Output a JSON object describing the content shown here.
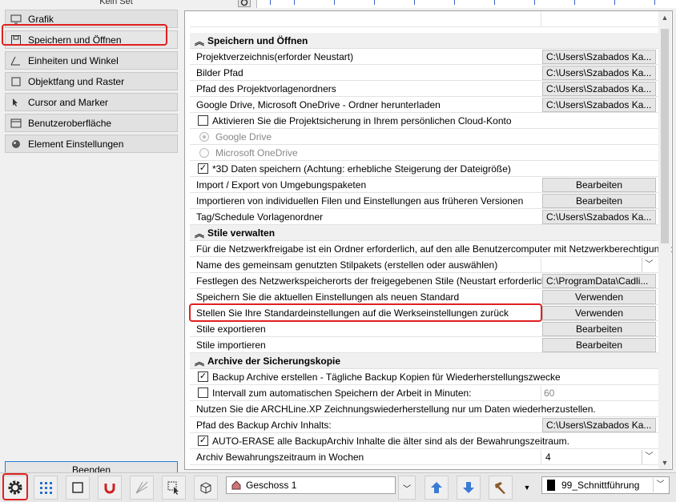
{
  "top": {
    "set_label": "Kein Set"
  },
  "nav": {
    "items": [
      {
        "label": "Grafik",
        "icon": "monitor-icon"
      },
      {
        "label": "Speichern und Öffnen",
        "icon": "floppy-disk-icon"
      },
      {
        "label": "Einheiten und Winkel",
        "icon": "angle-icon"
      },
      {
        "label": "Objektfang und Raster",
        "icon": "snap-frame-icon"
      },
      {
        "label": "Cursor and Marker",
        "icon": "cursor-icon"
      },
      {
        "label": "Benutzeroberfläche",
        "icon": "window-icon"
      },
      {
        "label": "Element Einstellungen",
        "icon": "sphere-icon"
      }
    ],
    "selected": "Speichern und Öffnen",
    "exit_label": "Beenden"
  },
  "settings": {
    "section1": {
      "title": "Speichern und Öffnen",
      "rows": {
        "projektverzeichnis": {
          "label": "Projektverzeichnis(erforder Neustart)",
          "value": "C:\\Users\\Szabados Ka..."
        },
        "bilder": {
          "label": "Bilder Pfad",
          "value": "C:\\Users\\Szabados Ka..."
        },
        "vorlagen": {
          "label": "Pfad des Projektvorlagenordners",
          "value": "C:\\Users\\Szabados Ka..."
        },
        "cloud_dl": {
          "label": "Google Drive, Microsoft OneDrive - Ordner herunterladen",
          "value": "C:\\Users\\Szabados Ka..."
        },
        "cloud_backup": {
          "label": "Aktivieren Sie die Projektsicherung in Ihrem persönlichen Cloud-Konto",
          "checked": false
        },
        "google": {
          "label": "Google Drive"
        },
        "onedrive": {
          "label": "Microsoft OneDrive"
        },
        "save3d": {
          "label": "*3D Daten speichern (Achtung: erhebliche Steigerung der Dateigröße)",
          "checked": true
        },
        "import_export": {
          "label": "Import / Export von Umgebungspaketen",
          "value": "Bearbeiten"
        },
        "import_files": {
          "label": "Importieren von individuellen Filen und Einstellungen aus früheren Versionen",
          "value": "Bearbeiten"
        },
        "tag_schedule": {
          "label": "Tag/Schedule Vorlagenordner",
          "value": "C:\\Users\\Szabados Ka..."
        }
      }
    },
    "section2": {
      "title": "Stile verwalten",
      "rows": {
        "info": {
          "label": "Für die Netzwerkfreigabe ist ein Ordner erforderlich, auf den alle Benutzercomputer mit Netzwerkberechtigung zu..."
        },
        "stilpaket": {
          "label": "Name des gemeinsam genutzten Stilpakets (erstellen oder auswählen)",
          "value": ""
        },
        "speicherort": {
          "label": "Festlegen des Netzwerkspeicherorts der freigegebenen Stile (Neustart erforderlich)",
          "value": "C:\\ProgramData\\Cadli..."
        },
        "als_standard": {
          "label": "Speichern Sie die aktuellen Einstellungen als neuen Standard",
          "value": "Verwenden"
        },
        "werkseinstellungen": {
          "label": "Stellen Sie Ihre Standardeinstellungen auf die Werkseinstellungen zurück",
          "value": "Verwenden"
        },
        "exportieren": {
          "label": "Stile exportieren",
          "value": "Bearbeiten"
        },
        "importieren": {
          "label": "Stile importieren",
          "value": "Bearbeiten"
        }
      }
    },
    "section3": {
      "title": "Archive der Sicherungskopie",
      "rows": {
        "backup": {
          "label": "Backup Archive erstellen - Tägliche Backup Kopien für Wiederherstellungszwecke",
          "checked": true
        },
        "intervall": {
          "label": "Intervall zum automatischen Speichern der Arbeit in Minuten:",
          "checked": false,
          "value": "60"
        },
        "info": {
          "label": "Nutzen Sie die ARCHLine.XP Zeichnungswiederherstellung nur um Daten wiederherzustellen."
        },
        "pfad": {
          "label": "Pfad des Backup Archiv Inhalts:",
          "value": "C:\\Users\\Szabados Ka..."
        },
        "auto_erase": {
          "label": "AUTO-ERASE alle BackupArchiv Inhalte die älter sind als der Bewahrungszeitraum.",
          "checked": true
        },
        "zeitraum": {
          "label": "Archiv Bewahrungszeitraum in Wochen",
          "value": "4"
        }
      }
    }
  },
  "toolbar": {
    "floor_label": "Geschoss 1",
    "layer_label": "99_Schnittführung",
    "buttons": [
      "gear-icon",
      "grid-dots-icon",
      "frame-snap-icon",
      "magnet-icon",
      "hatch-lines-icon",
      "select-cursor-icon",
      "3d-box-icon",
      "arrow-up-icon",
      "arrow-down-icon",
      "hammer-3d-icon"
    ]
  },
  "colors": {
    "highlight_red": "#e02020",
    "accent_blue": "#2a7bd3",
    "arrow_blue": "#3a7bd5"
  }
}
